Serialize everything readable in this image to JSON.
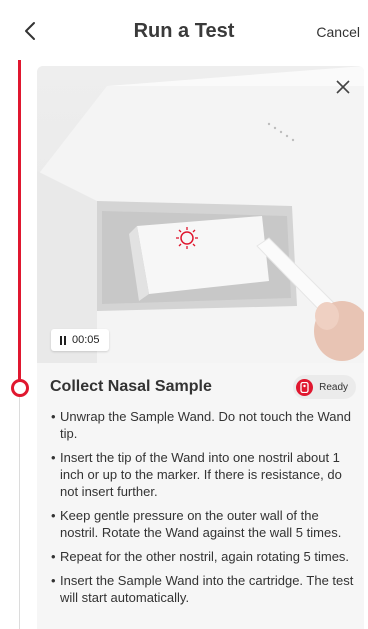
{
  "header": {
    "title": "Run a Test",
    "cancel_label": "Cancel"
  },
  "video": {
    "time": "00:05",
    "state": "paused"
  },
  "section": {
    "title": "Collect Nasal Sample",
    "status_label": "Ready"
  },
  "steps": [
    "Unwrap the Sample Wand. Do not touch the Wand tip.",
    "Insert the tip of the Wand into one nostril about 1 inch or up to the marker. If there is resistance, do not insert further.",
    "Keep gentle pressure on the outer wall of the nostril. Rotate the Wand against the wall 5 times.",
    "Repeat for the other nostril, again rotating 5 times.",
    "Insert the Sample Wand into the cartridge. The test will start automatically."
  ],
  "colors": {
    "accent": "#e0172f",
    "card_background": "#f6f6f6",
    "text": "#333333"
  },
  "icons": {
    "back": "chevron-left-icon",
    "close": "close-icon",
    "pause": "pause-icon",
    "ready": "device-icon"
  }
}
